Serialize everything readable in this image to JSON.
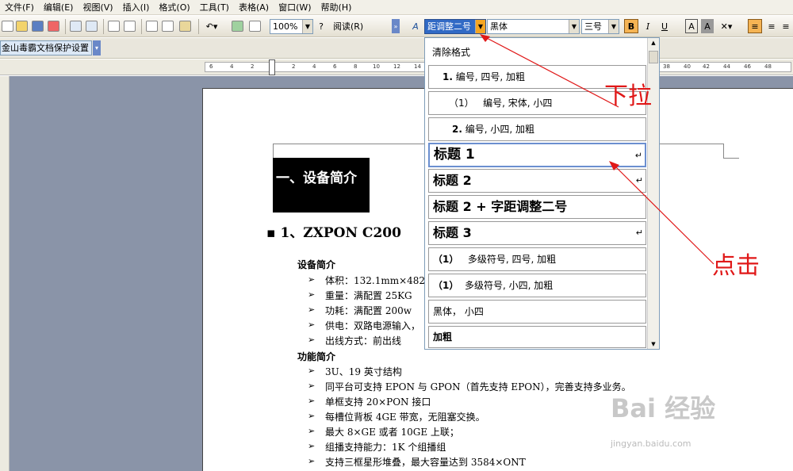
{
  "menu": [
    "文件(F)",
    "编辑(E)",
    "视图(V)",
    "插入(I)",
    "格式(O)",
    "工具(T)",
    "表格(A)",
    "窗口(W)",
    "帮助(H)"
  ],
  "toolbar": {
    "zoom": "100%",
    "read_label": "阅读(R)",
    "style_combo": "距调整二号",
    "font_combo": "黑体",
    "size_combo": "三号",
    "bold": "B",
    "italic": "I",
    "underline": "U",
    "charbox": "A",
    "charshade": "A"
  },
  "protect_toolbar": "金山毒霸文档保护设置",
  "ruler_left": [
    "6",
    "4",
    "2",
    "2",
    "4",
    "6",
    "8",
    "10",
    "12",
    "14"
  ],
  "ruler_right": [
    "38",
    "40",
    "42",
    "44",
    "46",
    "48"
  ],
  "style_list": [
    {
      "label": "清除格式"
    },
    {
      "label": "编号, 四号, 加粗",
      "prefix": "1."
    },
    {
      "label": "编号, 宋体, 小四",
      "prefix": "（1）"
    },
    {
      "label": "编号, 小四, 加粗",
      "prefix": "2."
    },
    {
      "label": "标题 1"
    },
    {
      "label": "标题 2"
    },
    {
      "label": "标题 2 + 字距调整二号"
    },
    {
      "label": "标题 3"
    },
    {
      "label": "多级符号, 四号, 加粗",
      "prefix": "（1）"
    },
    {
      "label": "多级符号, 小四, 加粗",
      "prefix": "（1）"
    },
    {
      "label": "黑体， 小四"
    },
    {
      "label": "加粗"
    }
  ],
  "annotations": {
    "dropdown": "下拉",
    "click": "点击"
  },
  "doc": {
    "h1": "一、设备简介",
    "h2": "1、ZXPON C200",
    "sub1": "设备简介",
    "bullets1": [
      "体积：132.1mm×482.",
      "重量：满配置 25KG",
      "功耗：满配置 200w",
      "供电：双路电源输入，",
      "出线方式：前出线"
    ],
    "sub2": "功能简介",
    "bullets2": [
      "3U、19 英寸结构",
      "同平台可支持 EPON 与 GPON（首先支持 EPON），完善支持多业务。",
      "单框支持 20×PON 接口",
      "每槽位背板 4GE 带宽，无阻塞交换。",
      "最大 8×GE 或者 10GE 上联；",
      "组播支持能力：1K 个组播组",
      "支持三框星形堆叠，最大容量达到 3584×ONT"
    ]
  },
  "watermark": {
    "brand": "Bai 经验",
    "url": "jingyan.baidu.com"
  }
}
